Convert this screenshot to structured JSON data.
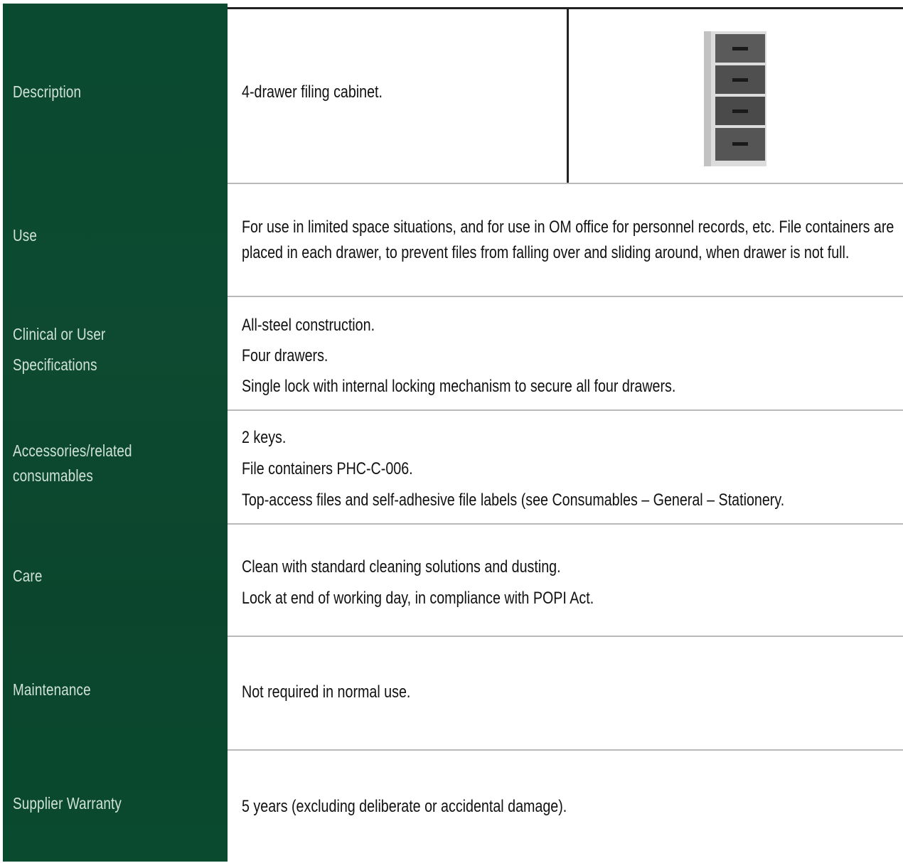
{
  "rows": [
    {
      "label_lines": [
        "Description"
      ],
      "content_lines": [
        "4-drawer filing cabinet."
      ]
    },
    {
      "label_lines": [
        "Use"
      ],
      "content_lines": [
        "For use in limited space situations, and for use in OM office for personnel records, etc. File containers are",
        "placed in each drawer, to prevent files from falling over and sliding around, when drawer is not full."
      ]
    },
    {
      "label_lines": [
        "Clinical or User",
        "Specifications"
      ],
      "content_lines": [
        "All-steel construction.",
        "Four drawers.",
        "Single lock with internal locking mechanism to secure all four drawers."
      ]
    },
    {
      "label_lines": [
        "Accessories/related",
        "consumables"
      ],
      "content_lines": [
        "2 keys.",
        "File containers PHC-C-006.",
        "Top-access files and self-adhesive file labels (see Consumables – General – Stationery."
      ]
    },
    {
      "label_lines": [
        "Care"
      ],
      "content_lines": [
        "Clean with standard cleaning solutions and dusting.",
        "Lock at end of working day, in compliance with POPI Act."
      ]
    },
    {
      "label_lines": [
        "Maintenance"
      ],
      "content_lines": [
        "Not required in normal use."
      ]
    },
    {
      "label_lines": [
        "Supplier Warranty"
      ],
      "content_lines": [
        "5 years (excluding deliberate or accidental damage)."
      ]
    }
  ],
  "image": {
    "icon": "filing-cabinet-icon"
  },
  "colors": {
    "sidebar": "#0b4a30",
    "label_text": "#cfe2d7",
    "body_text": "#111111"
  }
}
